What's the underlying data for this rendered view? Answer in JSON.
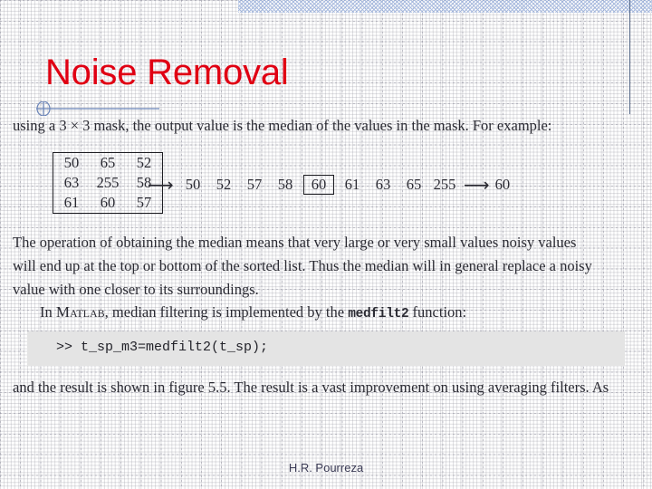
{
  "slide": {
    "title": "Noise Removal",
    "title_color": "#e00013",
    "footer": "H.R. Pourreza"
  },
  "content": {
    "paragraph_1": "using a 3 × 3 mask, the output value is the median of the values in the mask. For example:",
    "paragraph_2_line_1": "The operation of obtaining the median means that very large or very small values   noisy values",
    "paragraph_2_line_2": "will end up at the top or bottom of the sorted list. Thus the median will in general replace a noisy",
    "paragraph_2_line_3": "value with one closer to its surroundings.",
    "paragraph_3_prefix": "In ",
    "paragraph_3_smallcaps": "Matlab",
    "paragraph_3_middle": ", median filtering is implemented by the ",
    "paragraph_3_mono": "medfilt2",
    "paragraph_3_suffix": " function:",
    "code_line": ">> t_sp_m3=medfilt2(t_sp);",
    "paragraph_4": "and the result is shown in figure 5.5. The result is a vast improvement on using averaging filters. As"
  },
  "matrix": {
    "rows": [
      [
        "50",
        "65",
        "52"
      ],
      [
        "63",
        "255",
        "58"
      ],
      [
        "61",
        "60",
        "57"
      ]
    ]
  },
  "sorted": {
    "arrow_in": "⟶",
    "values": [
      "50",
      "52",
      "57",
      "58",
      "60",
      "61",
      "63",
      "65",
      "255"
    ],
    "median_index": 4,
    "arrow_out": "⟶",
    "result": "60"
  }
}
